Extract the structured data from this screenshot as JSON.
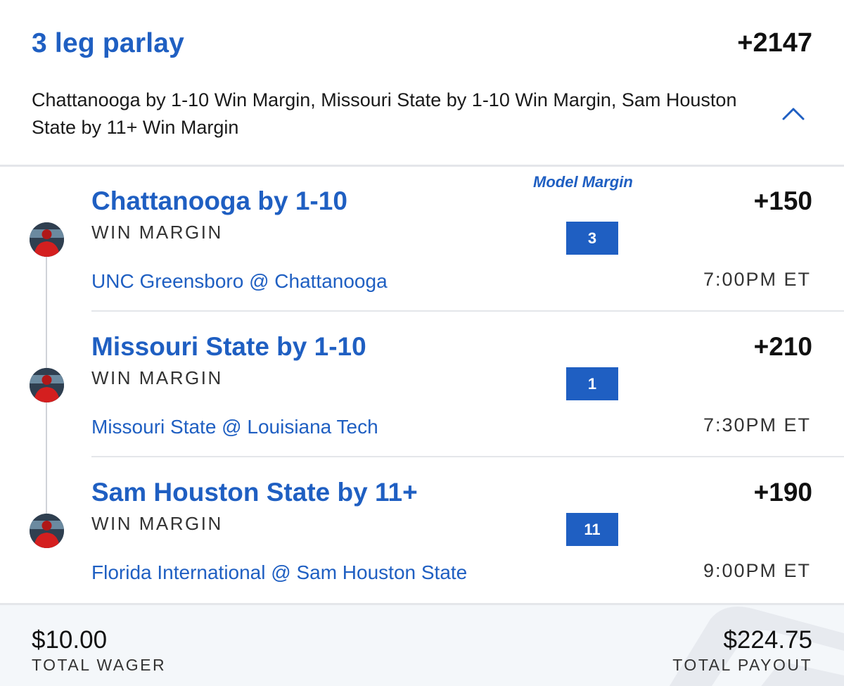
{
  "parlay": {
    "title": "3 leg parlay",
    "odds": "+2147",
    "summary": "Chattanooga by 1-10 Win Margin, Missouri State by 1-10 Win Margin, Sam Houston State by 11+ Win Margin"
  },
  "model_margin_label": "Model Margin",
  "legs": [
    {
      "title": "Chattanooga by 1-10",
      "type": "WIN MARGIN",
      "odds": "+150",
      "model_margin": "3",
      "game": "UNC Greensboro @ Chattanooga",
      "time": "7:00PM ET"
    },
    {
      "title": "Missouri State by 1-10",
      "type": "WIN MARGIN",
      "odds": "+210",
      "model_margin": "1",
      "game": "Missouri State @ Louisiana Tech",
      "time": "7:30PM ET"
    },
    {
      "title": "Sam Houston State by 11+",
      "type": "WIN MARGIN",
      "odds": "+190",
      "model_margin": "11",
      "game": "Florida International @ Sam Houston State",
      "time": "9:00PM ET"
    }
  ],
  "footer": {
    "wager_amount": "$10.00",
    "wager_label": "TOTAL WAGER",
    "payout_amount": "$224.75",
    "payout_label": "TOTAL PAYOUT"
  },
  "colors": {
    "accent": "#1f5fc2",
    "text": "#111111",
    "footer_bg": "#f4f7fa"
  },
  "icons": {
    "collapse": "chevron-up-icon",
    "avatar": "player-avatar-icon"
  }
}
